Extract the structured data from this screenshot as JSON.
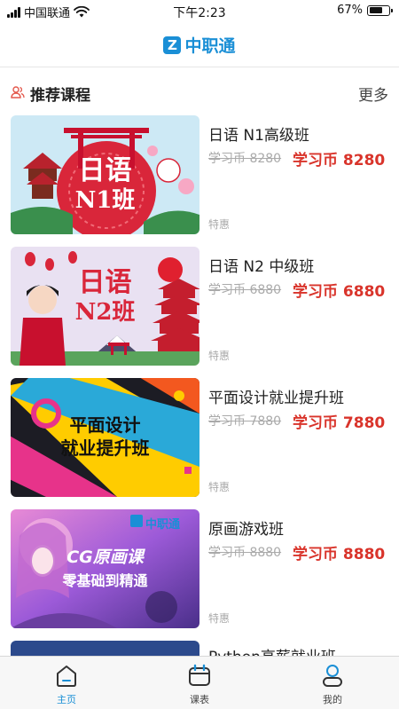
{
  "status_bar": {
    "carrier": "中国联通",
    "time": "下午2:23",
    "battery": "67%",
    "battery_level": 0.67
  },
  "nav": {
    "logo_letter": "Z",
    "title": "中职通"
  },
  "section": {
    "title": "推荐课程",
    "more_label": "更多",
    "icon": "users-icon"
  },
  "courses": [
    {
      "name": "日语 N1高级班",
      "old_price": "学习币 8280",
      "new_price": "学习币 8280",
      "tag": "特惠",
      "thumb_line1": "日语",
      "thumb_line2": "N1班"
    },
    {
      "name": "日语 N2 中级班",
      "old_price": "学习币 6880",
      "new_price": "学习币 6880",
      "tag": "特惠",
      "thumb_line1": "日语",
      "thumb_line2": "N2班"
    },
    {
      "name": "平面设计就业提升班",
      "old_price": "学习币 7880",
      "new_price": "学习币 7880",
      "tag": "特惠",
      "thumb_line1": "平面设计",
      "thumb_line2": "就业提升班"
    },
    {
      "name": "原画游戏班",
      "old_price": "学习币 8880",
      "new_price": "学习币 8880",
      "tag": "特惠",
      "thumb_logo": "中职通",
      "thumb_line1": "CG原画课",
      "thumb_line2": "零基础到精通"
    },
    {
      "name": "Python高薪就业班"
    }
  ],
  "tab_bar": {
    "tabs": [
      {
        "label": "主页",
        "icon": "home-icon",
        "active": true
      },
      {
        "label": "课表",
        "icon": "calendar-icon",
        "active": false
      },
      {
        "label": "我的",
        "icon": "profile-icon",
        "active": false
      }
    ]
  },
  "colors": {
    "accent": "#1a8fd6",
    "price": "#d9342b",
    "muted": "#aaaaaa"
  }
}
